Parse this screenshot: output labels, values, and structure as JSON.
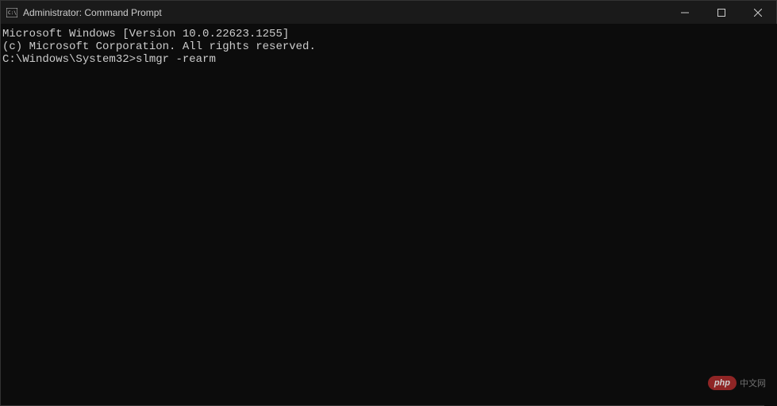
{
  "titlebar": {
    "title": "Administrator: Command Prompt"
  },
  "terminal": {
    "line1": "Microsoft Windows [Version 10.0.22623.1255]",
    "line2": "(c) Microsoft Corporation. All rights reserved.",
    "blank": "",
    "prompt": "C:\\Windows\\System32>",
    "command": "slmgr -rearm"
  },
  "watermark": {
    "badge": "php",
    "text": "中文网"
  }
}
